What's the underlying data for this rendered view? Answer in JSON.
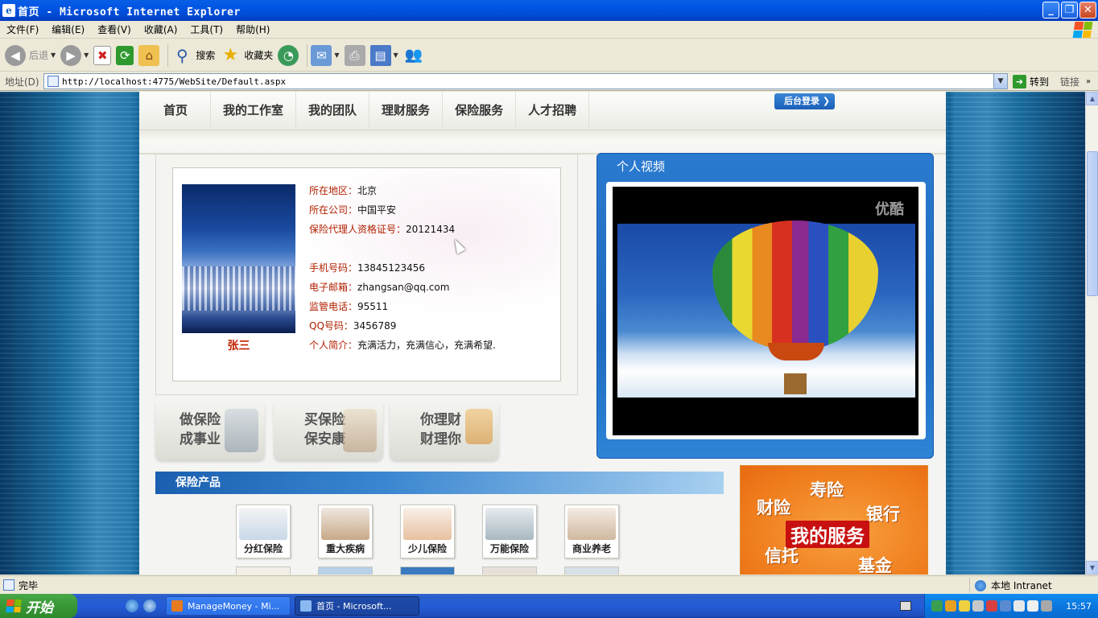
{
  "window": {
    "title": "首页 - Microsoft Internet Explorer",
    "controls": {
      "minimize": "_",
      "maximize": "❐",
      "close": "✕"
    }
  },
  "menu": [
    "文件(F)",
    "编辑(E)",
    "查看(V)",
    "收藏(A)",
    "工具(T)",
    "帮助(H)"
  ],
  "toolbar": {
    "back": "后退",
    "search": "搜索",
    "favorites": "收藏夹"
  },
  "address": {
    "label": "地址(D)",
    "url": "http://localhost:4775/WebSite/Default.aspx",
    "go": "转到",
    "links": "链接"
  },
  "site": {
    "nav": [
      "首页",
      "我的工作室",
      "我的团队",
      "理财服务",
      "保险服务",
      "人才招聘"
    ],
    "admin_login": "后台登录",
    "profile": {
      "name": "张三",
      "fields": [
        {
          "label": "所在地区：",
          "value": "北京"
        },
        {
          "label": "所在公司：",
          "value": "中国平安"
        },
        {
          "label": "保险代理人资格证号：",
          "value": "20121434"
        },
        {
          "label": "手机号码：",
          "value": "13845123456"
        },
        {
          "label": "电子邮箱：",
          "value": "zhangsan@qq.com"
        },
        {
          "label": "监管电话：",
          "value": "95511"
        },
        {
          "label": "QQ号码：",
          "value": "3456789"
        },
        {
          "label": "个人简介：",
          "value": "充满活力，充满信心，充满希望."
        }
      ]
    },
    "promos": [
      {
        "line1": "做保险",
        "line2": "成事业"
      },
      {
        "line1": "买保险",
        "line2": "保安康"
      },
      {
        "line1": "你理财",
        "line2": "财理你"
      }
    ],
    "video": {
      "title": "个人视频",
      "watermark": "优酷"
    },
    "products": {
      "title": "保险产品",
      "items": [
        "分红保险",
        "重大疾病",
        "少儿保险",
        "万能保险",
        "商业养老"
      ]
    },
    "service_banner": {
      "words": [
        "寿险",
        "财险",
        "银行",
        "信托",
        "基金"
      ],
      "headline": "我的服务"
    }
  },
  "statusbar": {
    "status": "完毕",
    "zone": "本地 Intranet"
  },
  "taskbar": {
    "start": "开始",
    "tasks": [
      "ManageMoney - Mi...",
      "首页 - Microsoft..."
    ],
    "clock": "15:57"
  },
  "colors": {
    "xp_blue": "#0054e3",
    "label_red": "#b02000",
    "name_red": "#c02000",
    "service_orange": "#f08020"
  }
}
